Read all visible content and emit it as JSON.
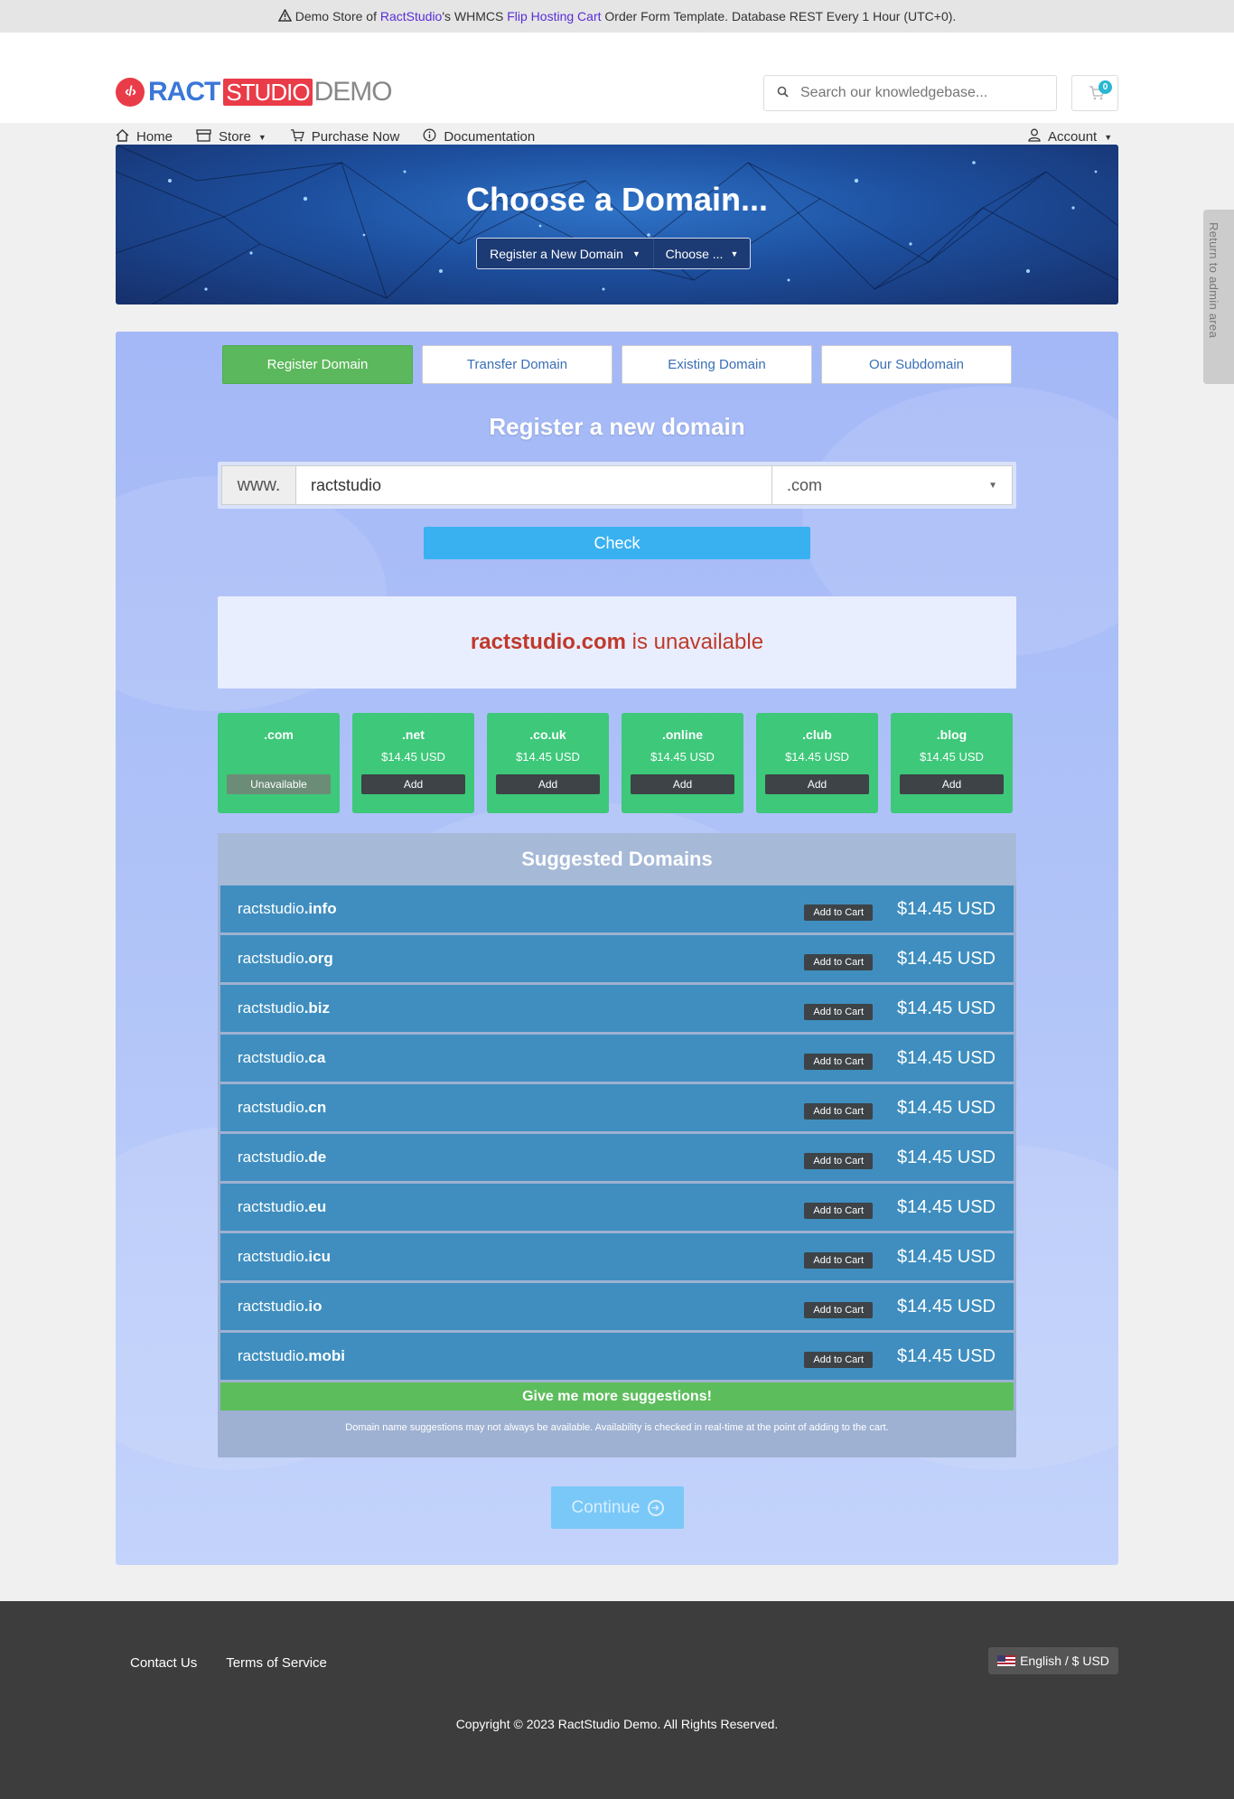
{
  "topbar": {
    "prefix": "Demo Store of ",
    "brand_link": "RactStudio",
    "mid": "'s WHMCS ",
    "template_link": "Flip Hosting Cart",
    "suffix": " Order Form Template. Database REST Every 1 Hour (UTC+0)."
  },
  "logo": {
    "part1": "RACT",
    "part2": "STUDIO",
    "part3": "DEMO"
  },
  "search": {
    "placeholder": "Search our knowledgebase..."
  },
  "cart": {
    "count": "0"
  },
  "nav": {
    "home": "Home",
    "store": "Store",
    "purchase": "Purchase Now",
    "docs": "Documentation",
    "account": "Account"
  },
  "hero": {
    "title": "Choose a Domain...",
    "dropdown1": "Register a New Domain",
    "dropdown2": "Choose ..."
  },
  "admin_tab": "Return to admin area",
  "tabs": [
    "Register Domain",
    "Transfer Domain",
    "Existing Domain",
    "Our Subdomain"
  ],
  "register": {
    "title": "Register a new domain",
    "prefix": "www.",
    "domain_value": "ractstudio",
    "tld": ".com",
    "check": "Check"
  },
  "result": {
    "domain": "ractstudio.com",
    "message": " is unavailable"
  },
  "tld_cards": [
    {
      "name": ".com",
      "price": "",
      "button": "Unavailable"
    },
    {
      "name": ".net",
      "price": "$14.45 USD",
      "button": "Add"
    },
    {
      "name": ".co.uk",
      "price": "$14.45 USD",
      "button": "Add"
    },
    {
      "name": ".online",
      "price": "$14.45 USD",
      "button": "Add"
    },
    {
      "name": ".club",
      "price": "$14.45 USD",
      "button": "Add"
    },
    {
      "name": ".blog",
      "price": "$14.45 USD",
      "button": "Add"
    }
  ],
  "suggested": {
    "title": "Suggested Domains",
    "items": [
      {
        "sld": "ractstudio",
        "tld": ".info",
        "button": "Add to Cart",
        "price": "$14.45 USD"
      },
      {
        "sld": "ractstudio",
        "tld": ".org",
        "button": "Add to Cart",
        "price": "$14.45 USD"
      },
      {
        "sld": "ractstudio",
        "tld": ".biz",
        "button": "Add to Cart",
        "price": "$14.45 USD"
      },
      {
        "sld": "ractstudio",
        "tld": ".ca",
        "button": "Add to Cart",
        "price": "$14.45 USD"
      },
      {
        "sld": "ractstudio",
        "tld": ".cn",
        "button": "Add to Cart",
        "price": "$14.45 USD"
      },
      {
        "sld": "ractstudio",
        "tld": ".de",
        "button": "Add to Cart",
        "price": "$14.45 USD"
      },
      {
        "sld": "ractstudio",
        "tld": ".eu",
        "button": "Add to Cart",
        "price": "$14.45 USD"
      },
      {
        "sld": "ractstudio",
        "tld": ".icu",
        "button": "Add to Cart",
        "price": "$14.45 USD"
      },
      {
        "sld": "ractstudio",
        "tld": ".io",
        "button": "Add to Cart",
        "price": "$14.45 USD"
      },
      {
        "sld": "ractstudio",
        "tld": ".mobi",
        "button": "Add to Cart",
        "price": "$14.45 USD"
      }
    ],
    "more": "Give me more suggestions!",
    "disclaimer": "Domain name suggestions may not always be available. Availability is checked in real-time at the point of adding to the cart."
  },
  "continue": "Continue",
  "footer": {
    "contact": "Contact Us",
    "terms": "Terms of Service",
    "language": "English / $ USD",
    "copyright": "Copyright © 2023 RactStudio Demo. All Rights Reserved."
  },
  "colors": {
    "brand_red": "#e93b48",
    "brand_blue": "#3b77d8",
    "tab_active": "#5cb85c",
    "check_button": "#39b1f1",
    "tld_card": "#3ec87a",
    "suggestion_row": "#3f8ebf",
    "unavailable_text": "#c0392b",
    "footer_bg": "#3d3d3d"
  }
}
